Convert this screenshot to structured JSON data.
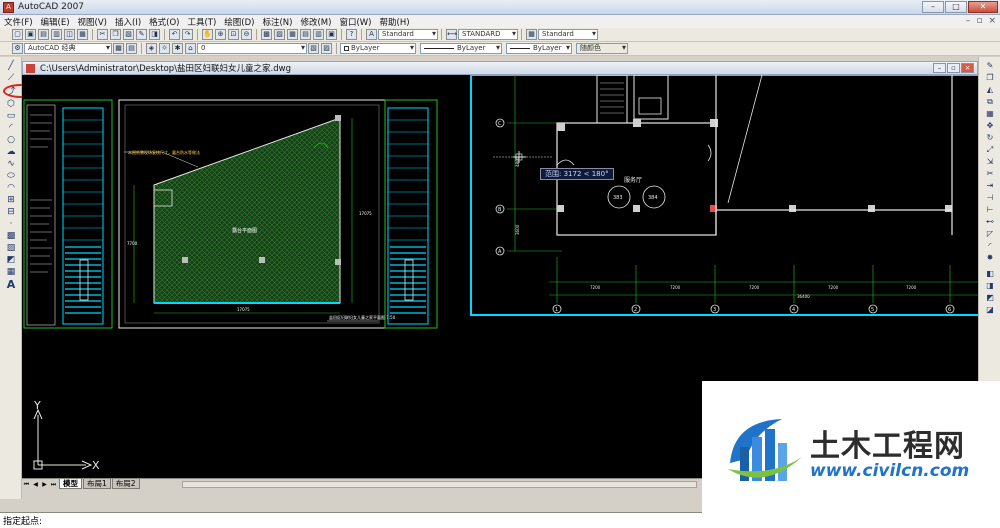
{
  "window": {
    "title": "AutoCAD 2007",
    "icon": "autocad-app-icon",
    "buttons": [
      "minimize",
      "maximize",
      "close"
    ]
  },
  "menu": [
    "文件(F)",
    "编辑(E)",
    "视图(V)",
    "插入(I)",
    "格式(O)",
    "工具(T)",
    "绘图(D)",
    "标注(N)",
    "修改(M)",
    "窗口(W)",
    "帮助(H)"
  ],
  "toolbar": {
    "workspace": "AutoCAD 经典",
    "layer": "0",
    "text_style": "Standard",
    "dim_style": "STANDARD",
    "table_style": "Standard",
    "color": "ByLayer",
    "linetype": "ByLayer",
    "lineweight": "ByLayer",
    "plot_style": "随颜色"
  },
  "drawing": {
    "path": "C:\\Users\\Administrator\\Desktop\\盐田区妇联妇女儿童之家.dwg",
    "labels": {
      "room_hall": "服务厅",
      "room1": "383",
      "room2": "384",
      "balcony": "露台平面图",
      "plan_caption": "盐田区妇联妇女儿童之家平面图 1:50",
      "note": "本图纸需现场复核尺寸，露台防水等做法"
    },
    "dimensions": [
      "7200",
      "7200",
      "7200",
      "7200",
      "7200",
      "36400",
      "17075",
      "17075",
      "7700",
      "3600",
      "4800"
    ],
    "axis_letters": [
      "C",
      "B",
      "A"
    ],
    "axis_numbers": [
      "1",
      "2",
      "3",
      "4",
      "5",
      "6"
    ],
    "tooltip": "范围: 3172 < 180°",
    "ucs": {
      "x": "X",
      "y": "Y"
    }
  },
  "tabs": [
    "模型",
    "布局1",
    "布局2"
  ],
  "command": {
    "prompt": "指定起点:"
  },
  "watermark": {
    "title": "土木工程网",
    "url": "www.civilcn.com"
  },
  "colors": {
    "canvas": "#000000",
    "cyan": "#00d8ff",
    "green": "#20c020",
    "hatch": "#1b4f1b",
    "highlight": "#e12020",
    "watermark_blue": "#1f73c9"
  }
}
